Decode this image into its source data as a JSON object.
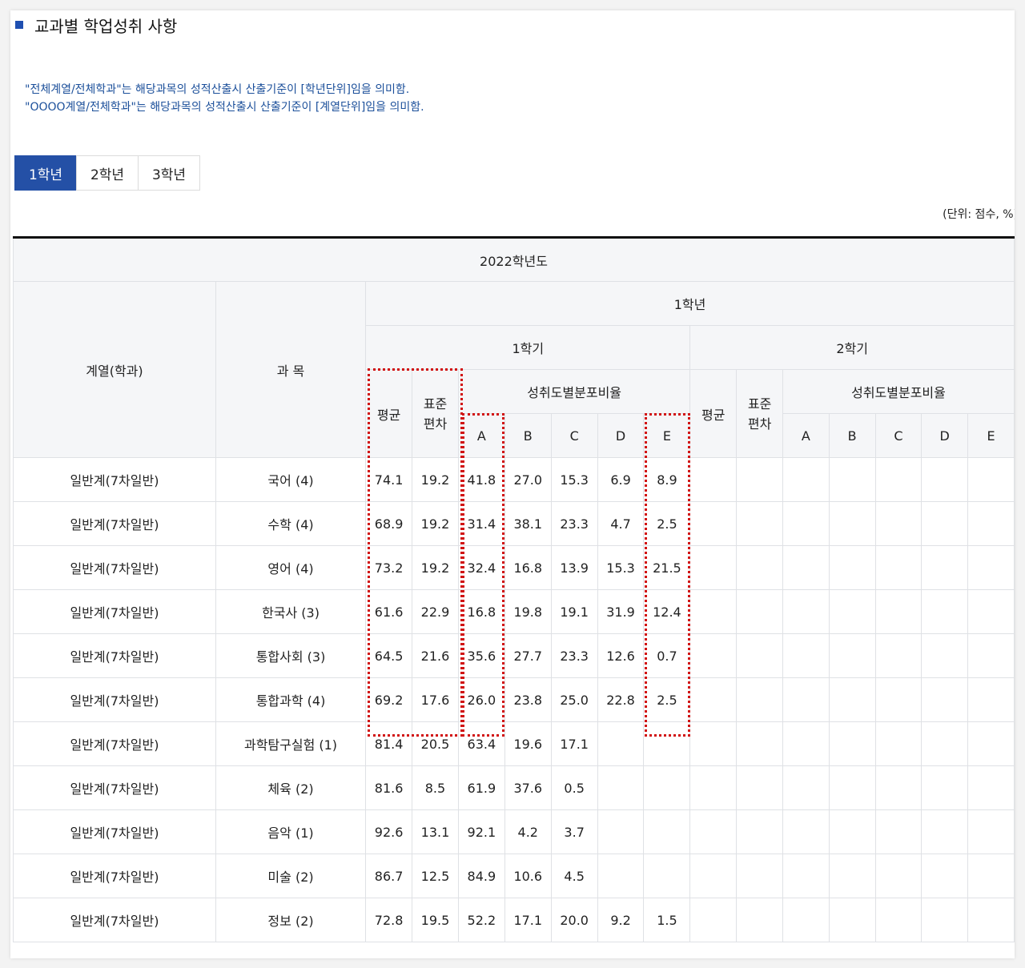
{
  "section_title": "교과별 학업성취 사항",
  "notes": [
    "\"전체계열/전체학과\"는 해당과목의 성적산출시 산출기준이 [학년단위]임을 의미함.",
    "\"OOOO계열/전체학과\"는 해당과목의 성적산출시 산출기준이 [계열단위]임을 의미함."
  ],
  "tabs": [
    {
      "label": "1학년",
      "active": true
    },
    {
      "label": "2학년",
      "active": false
    },
    {
      "label": "3학년",
      "active": false
    }
  ],
  "unit_label": "(단위: 점수, %)",
  "table": {
    "year_header": "2022학년도",
    "col_dept": "계열(학과)",
    "col_subject": "과 목",
    "grade_header": "1학년",
    "semesters": [
      "1학기",
      "2학기"
    ],
    "avg_label": "평균",
    "std_label_line1": "표준",
    "std_label_line2": "편차",
    "dist_label": "성취도별분포비율",
    "levels": [
      "A",
      "B",
      "C",
      "D",
      "E"
    ],
    "rows": [
      {
        "dept": "일반계(7차일반)",
        "subject": "국어 (4)",
        "avg": "74.1",
        "std": "19.2",
        "a": "41.8",
        "b": "27.0",
        "c": "15.3",
        "d": "6.9",
        "e": "8.9"
      },
      {
        "dept": "일반계(7차일반)",
        "subject": "수학 (4)",
        "avg": "68.9",
        "std": "19.2",
        "a": "31.4",
        "b": "38.1",
        "c": "23.3",
        "d": "4.7",
        "e": "2.5"
      },
      {
        "dept": "일반계(7차일반)",
        "subject": "영어 (4)",
        "avg": "73.2",
        "std": "19.2",
        "a": "32.4",
        "b": "16.8",
        "c": "13.9",
        "d": "15.3",
        "e": "21.5"
      },
      {
        "dept": "일반계(7차일반)",
        "subject": "한국사 (3)",
        "avg": "61.6",
        "std": "22.9",
        "a": "16.8",
        "b": "19.8",
        "c": "19.1",
        "d": "31.9",
        "e": "12.4"
      },
      {
        "dept": "일반계(7차일반)",
        "subject": "통합사회 (3)",
        "avg": "64.5",
        "std": "21.6",
        "a": "35.6",
        "b": "27.7",
        "c": "23.3",
        "d": "12.6",
        "e": "0.7"
      },
      {
        "dept": "일반계(7차일반)",
        "subject": "통합과학 (4)",
        "avg": "69.2",
        "std": "17.6",
        "a": "26.0",
        "b": "23.8",
        "c": "25.0",
        "d": "22.8",
        "e": "2.5"
      },
      {
        "dept": "일반계(7차일반)",
        "subject": "과학탐구실험 (1)",
        "avg": "81.4",
        "std": "20.5",
        "a": "63.4",
        "b": "19.6",
        "c": "17.1",
        "d": "",
        "e": ""
      },
      {
        "dept": "일반계(7차일반)",
        "subject": "체육 (2)",
        "avg": "81.6",
        "std": "8.5",
        "a": "61.9",
        "b": "37.6",
        "c": "0.5",
        "d": "",
        "e": ""
      },
      {
        "dept": "일반계(7차일반)",
        "subject": "음악 (1)",
        "avg": "92.6",
        "std": "13.1",
        "a": "92.1",
        "b": "4.2",
        "c": "3.7",
        "d": "",
        "e": ""
      },
      {
        "dept": "일반계(7차일반)",
        "subject": "미술 (2)",
        "avg": "86.7",
        "std": "12.5",
        "a": "84.9",
        "b": "10.6",
        "c": "4.5",
        "d": "",
        "e": ""
      },
      {
        "dept": "일반계(7차일반)",
        "subject": "정보 (2)",
        "avg": "72.8",
        "std": "19.5",
        "a": "52.2",
        "b": "17.1",
        "c": "20.0",
        "d": "9.2",
        "e": "1.5"
      }
    ]
  },
  "colors": {
    "accent": "#2450a6",
    "note_text": "#1b4f9a",
    "highlight": "#d11212",
    "header_bg": "#f5f6f8"
  }
}
